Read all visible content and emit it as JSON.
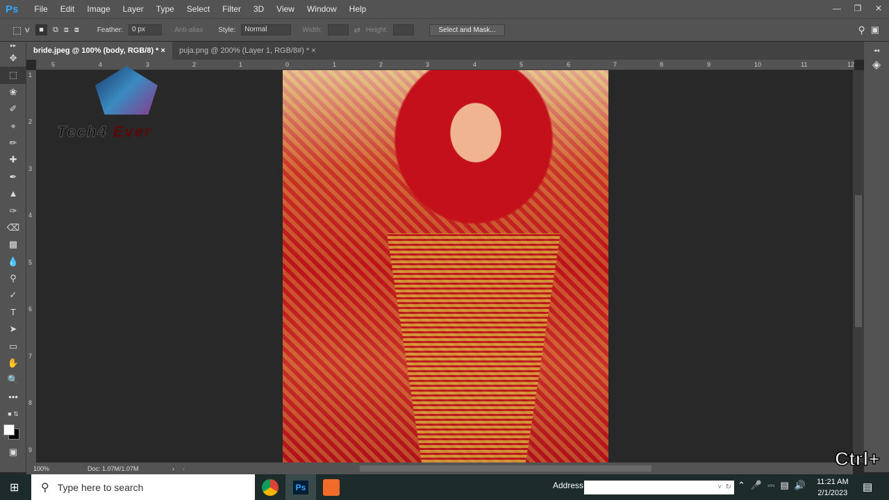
{
  "app": {
    "logo": "Ps"
  },
  "menu": [
    "File",
    "Edit",
    "Image",
    "Layer",
    "Type",
    "Select",
    "Filter",
    "3D",
    "View",
    "Window",
    "Help"
  ],
  "window_controls": [
    "minimize",
    "restore",
    "close"
  ],
  "options": {
    "feather_label": "Feather:",
    "feather_value": "0 px",
    "anti_alias": "Anti-alias",
    "style_label": "Style:",
    "style_value": "Normal",
    "width_label": "Width:",
    "height_label": "Height:",
    "select_mask": "Select and Mask..."
  },
  "tabs": [
    {
      "label": "bride.jpeg @ 100% (body, RGB/8) *"
    },
    {
      "label": "puja.png @ 200% (Layer 1, RGB/8#) *"
    }
  ],
  "ruler_top": [
    "5",
    "4",
    "3",
    "2",
    "1",
    "0",
    "1",
    "2",
    "3",
    "4",
    "5",
    "6",
    "7",
    "8",
    "9",
    "10",
    "11",
    "12"
  ],
  "ruler_left": [
    "1",
    "2",
    "3",
    "4",
    "5",
    "6",
    "7",
    "8",
    "9"
  ],
  "status": {
    "zoom": "100%",
    "doc": "Doc: 1.07M/1.07M"
  },
  "watermark": {
    "text1": "Tech4",
    "text2": "Ever"
  },
  "overlay": "Ctrl+",
  "taskbar": {
    "search_placeholder": "Type here to search",
    "address_label": "Address",
    "time": "11:21 AM",
    "date": "2/1/2023"
  }
}
